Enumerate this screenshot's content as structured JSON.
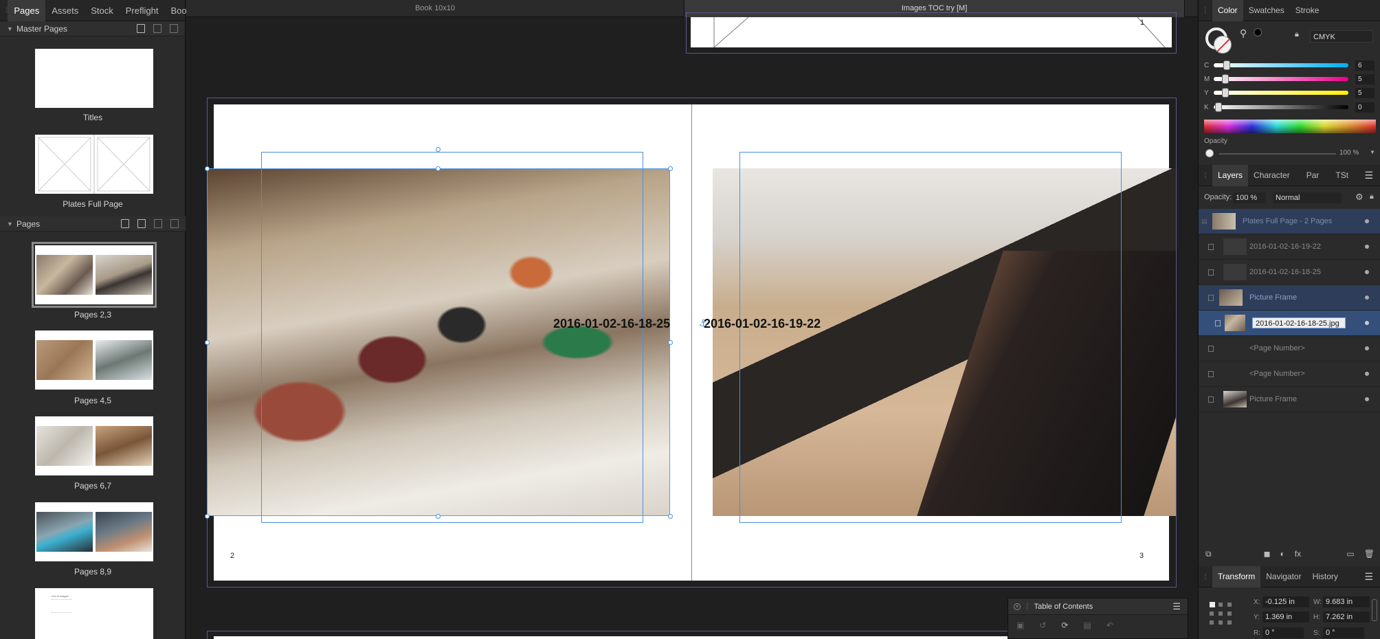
{
  "left_panel": {
    "tabs": [
      {
        "label": "Pages",
        "active": true
      },
      {
        "label": "Assets",
        "active": false
      },
      {
        "label": "Stock",
        "active": false
      },
      {
        "label": "Preflight",
        "active": false
      },
      {
        "label": "Books",
        "active": false
      }
    ],
    "master_section_title": "Master Pages",
    "master_pages": [
      {
        "label": "Titles"
      },
      {
        "label": "Plates Full Page"
      }
    ],
    "pages_section_title": "Pages",
    "pages": [
      {
        "label": "Pages 2,3",
        "selected": true
      },
      {
        "label": "Pages 4,5",
        "selected": false
      },
      {
        "label": "Pages 6,7",
        "selected": false
      },
      {
        "label": "Pages 8,9",
        "selected": false
      },
      {
        "label": "",
        "selected": false
      }
    ],
    "toc_thumb_text": "List of images"
  },
  "document_tabs": [
    {
      "label": "Book 10x10",
      "active": false
    },
    {
      "label": "Images TOC try [M]",
      "active": true
    }
  ],
  "canvas": {
    "top_page_number": "1",
    "left_caption": "2016-01-02-16-18-25",
    "right_caption": "2016-01-02-16-19-22",
    "left_page_number": "2",
    "right_page_number": "3"
  },
  "color_panel": {
    "tabs": [
      {
        "label": "Color",
        "active": true
      },
      {
        "label": "Swatches",
        "active": false
      },
      {
        "label": "Stroke",
        "active": false
      }
    ],
    "model": "CMYK",
    "sliders": [
      {
        "label": "C",
        "value": "6",
        "fraction": 0.06
      },
      {
        "label": "M",
        "value": "5",
        "fraction": 0.05
      },
      {
        "label": "Y",
        "value": "5",
        "fraction": 0.05
      },
      {
        "label": "K",
        "value": "0",
        "fraction": 0.0
      }
    ],
    "opacity_label": "Opacity",
    "opacity_value": "100 %"
  },
  "layers_panel": {
    "tabs": [
      {
        "label": "Layers",
        "active": true
      },
      {
        "label": "Character",
        "active": false
      },
      {
        "label": "Par",
        "active": false
      },
      {
        "label": "TSt",
        "active": false
      }
    ],
    "opacity_label": "Opacity:",
    "opacity_value": "100 %",
    "blend_mode": "Normal",
    "layers": [
      {
        "name": "Plates Full Page - 2 Pages",
        "highlight": "master"
      },
      {
        "name": "2016-01-02-16-19-22",
        "highlight": "none"
      },
      {
        "name": "2016-01-02-16-18-25",
        "highlight": "none"
      },
      {
        "name": "Picture Frame",
        "highlight": "frame"
      },
      {
        "name": "2016-01-02-16-18-25.jpg",
        "highlight": "selected"
      },
      {
        "name": "<Page Number>",
        "highlight": "none"
      },
      {
        "name": "<Page Number>",
        "highlight": "none"
      },
      {
        "name": "Picture Frame",
        "highlight": "none"
      }
    ]
  },
  "transform_panel": {
    "tabs": [
      {
        "label": "Transform",
        "active": true
      },
      {
        "label": "Navigator",
        "active": false
      },
      {
        "label": "History",
        "active": false
      }
    ],
    "x_label": "X:",
    "x": "-0.125 in",
    "y_label": "Y:",
    "y": "1.369 in",
    "w_label": "W:",
    "w": "9.683 in",
    "h_label": "H:",
    "h": "7.262 in",
    "r_label": "R:",
    "r": "0 °",
    "s_label": "S:",
    "s": "0 °"
  },
  "toc_panel": {
    "title": "Table of Contents"
  }
}
